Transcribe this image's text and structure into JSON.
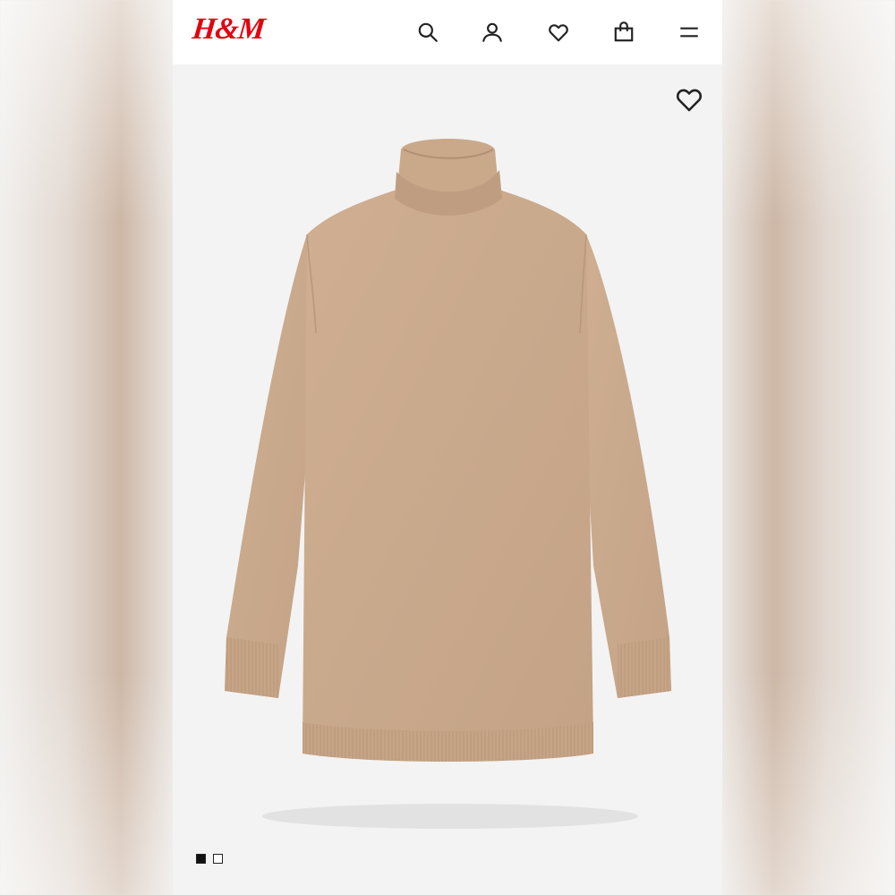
{
  "header": {
    "logo": "H&M",
    "icons": [
      "search-icon",
      "account-icon",
      "favorites-icon",
      "shopping-bag-icon",
      "menu-icon"
    ]
  },
  "product": {
    "favorite_icon": "heart-outline-icon",
    "image_description_icon": "sweater-dress-image",
    "image_count": 2,
    "active_image_index": 0
  },
  "colors": {
    "brand": "#e50010",
    "knit": "#c9a98c",
    "background": "#f3f3f3"
  }
}
